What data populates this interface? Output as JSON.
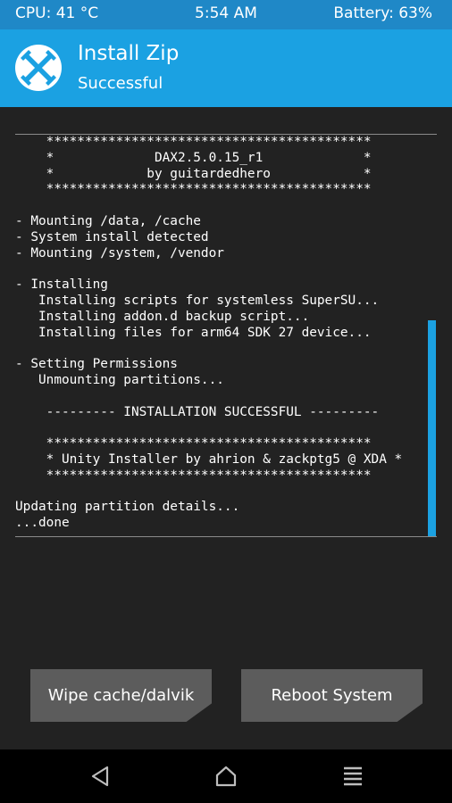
{
  "status_bar": {
    "cpu": "CPU: 41 °C",
    "time": "5:54 AM",
    "battery": "Battery: 63%"
  },
  "header": {
    "title": "Install Zip",
    "subtitle": "Successful",
    "logo_icon": "twrp-logo-icon"
  },
  "console": {
    "lines": [
      "    ******************************************",
      "    *             DAX2.5.0.15_r1             *",
      "    *            by guitardedhero            *",
      "    ******************************************",
      "",
      "- Mounting /data, /cache",
      "- System install detected",
      "- Mounting /system, /vendor",
      "",
      "- Installing",
      "   Installing scripts for systemless SuperSU...",
      "   Installing addon.d backup script...",
      "   Installing files for arm64 SDK 27 device...",
      "",
      "- Setting Permissions",
      "   Unmounting partitions...",
      "",
      "    --------- INSTALLATION SUCCESSFUL ---------",
      "",
      "    ******************************************",
      "    * Unity Installer by ahrion & zackptg5 @ XDA *",
      "    ******************************************",
      "",
      "Updating partition details...",
      "...done"
    ]
  },
  "buttons": {
    "wipe": "Wipe cache/dalvik",
    "reboot": "Reboot System"
  },
  "nav": {
    "back_icon": "back-triangle-icon",
    "home_icon": "home-icon",
    "menu_icon": "menu-lines-icon"
  },
  "colors": {
    "accent": "#1ba1e2",
    "status_bar": "#1f88c7",
    "background": "#222222",
    "button": "#5c5c5c"
  }
}
